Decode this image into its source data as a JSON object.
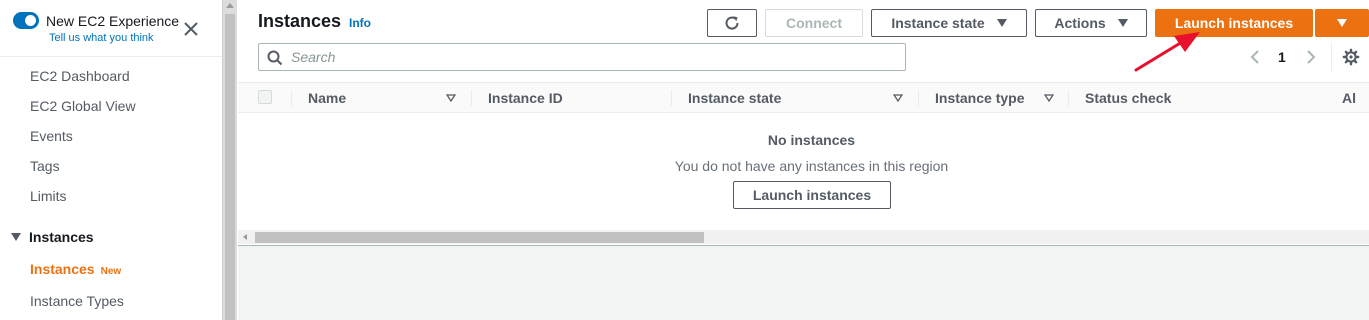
{
  "sidebar": {
    "experience_title": "New EC2 Experience",
    "experience_link": "Tell us what you think",
    "items": [
      {
        "label": "EC2 Dashboard"
      },
      {
        "label": "EC2 Global View"
      },
      {
        "label": "Events"
      },
      {
        "label": "Tags"
      },
      {
        "label": "Limits"
      }
    ],
    "section": {
      "label": "Instances",
      "expanded": true
    },
    "section_items": [
      {
        "label": "Instances",
        "badge": "New",
        "active": true
      },
      {
        "label": "Instance Types"
      }
    ],
    "toggle_on": true
  },
  "header": {
    "title": "Instances",
    "info_label": "Info",
    "buttons": {
      "connect": "Connect",
      "instance_state": "Instance state",
      "actions": "Actions",
      "launch": "Launch instances"
    }
  },
  "search": {
    "placeholder": "Search",
    "value": ""
  },
  "pagination": {
    "page": "1"
  },
  "table": {
    "columns": [
      "Name",
      "Instance ID",
      "Instance state",
      "Instance type",
      "Status check",
      "Al"
    ]
  },
  "empty_state": {
    "title": "No instances",
    "description": "You do not have any instances in this region",
    "button": "Launch instances"
  },
  "colors": {
    "accent": "#ec7211",
    "link": "#0073bb",
    "annotation_arrow": "#e8112d"
  },
  "icons": [
    "close-icon",
    "refresh-icon",
    "search-icon",
    "chevron-left-icon",
    "chevron-right-icon",
    "settings-icon",
    "filter-sort-icon",
    "caret-down-icon"
  ]
}
